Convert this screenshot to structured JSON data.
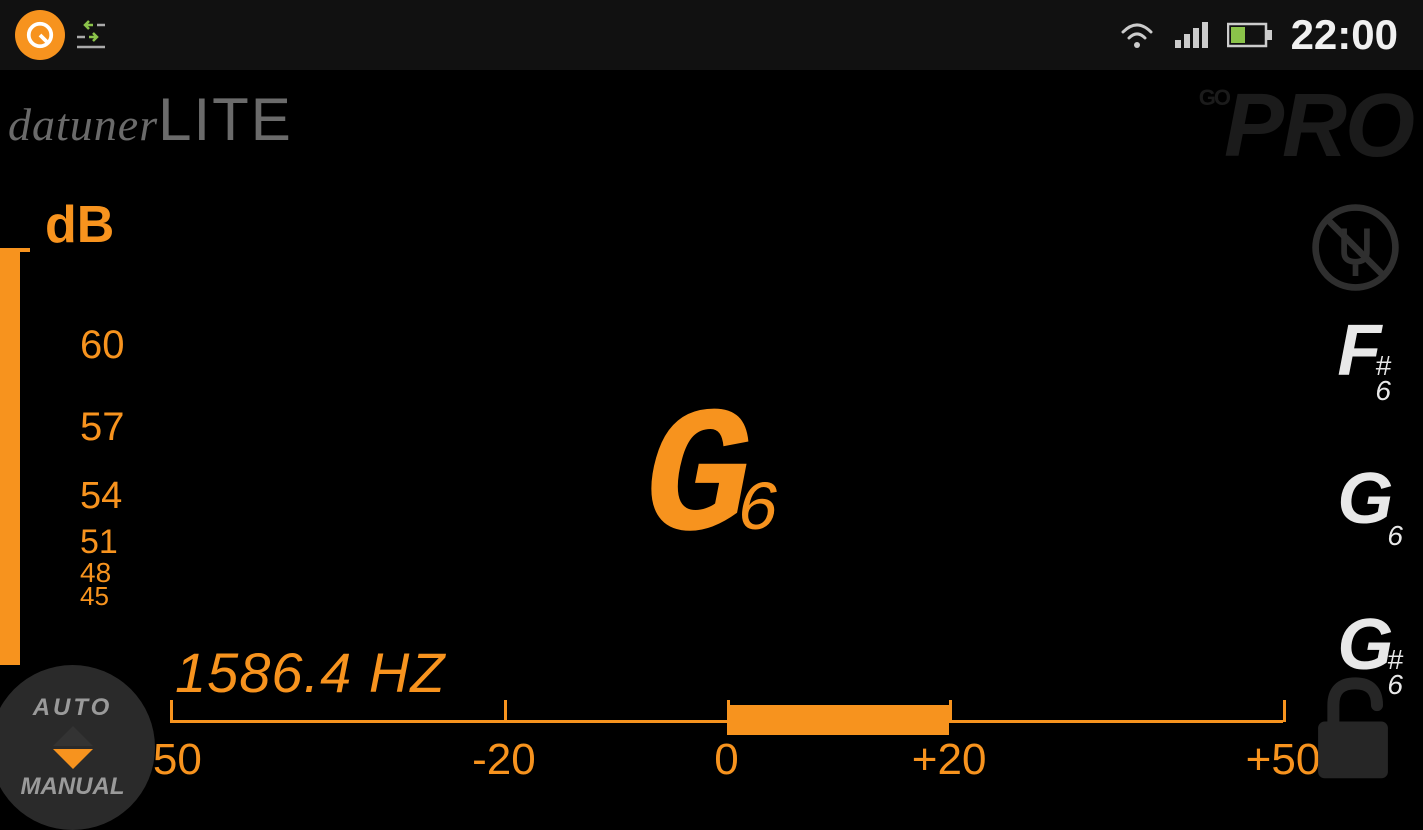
{
  "status_bar": {
    "time": "22:00"
  },
  "brand": {
    "script": "datuner",
    "lite": "LITE"
  },
  "go_pro": {
    "go": "GO",
    "pro": "PRO"
  },
  "db": {
    "label": "dB",
    "scale": [
      "60",
      "57",
      "54",
      "51",
      "48",
      "45"
    ]
  },
  "main_note": {
    "note": "G",
    "octave": "6"
  },
  "frequency": "1586.4 HZ",
  "cents": {
    "labels": [
      "-50",
      "-20",
      "0",
      "+20",
      "+50"
    ],
    "positions": [
      0,
      30,
      50,
      70,
      100
    ],
    "indicator_start_pct": 50,
    "indicator_end_pct": 70
  },
  "auto_manual": {
    "auto": "AUTO",
    "manual": "MANUAL"
  },
  "note_list": [
    {
      "note": "F",
      "sharp": "#",
      "octave": "6"
    },
    {
      "note": "G",
      "sharp": "",
      "octave": "6"
    },
    {
      "note": "G",
      "sharp": "#",
      "octave": "6"
    }
  ]
}
